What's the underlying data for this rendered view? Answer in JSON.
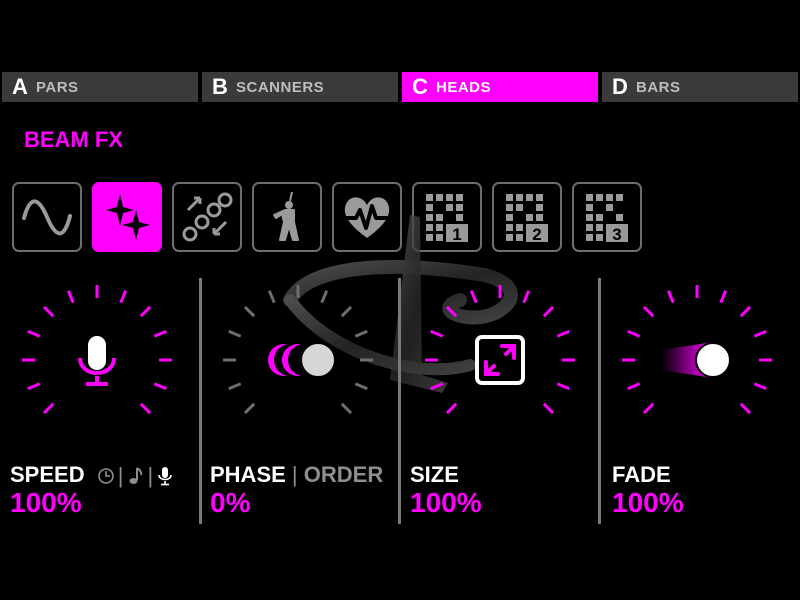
{
  "tabs": [
    {
      "letter": "A",
      "label": "PARS",
      "active": false
    },
    {
      "letter": "B",
      "label": "SCANNERS",
      "active": false
    },
    {
      "letter": "C",
      "label": "HEADS",
      "active": true
    },
    {
      "letter": "D",
      "label": "BARS",
      "active": false
    }
  ],
  "section": {
    "title": "BEAM FX"
  },
  "effects": [
    {
      "icon": "sine-wave-icon",
      "active": false
    },
    {
      "icon": "sparkle-icon",
      "active": true
    },
    {
      "icon": "dots-arrows-icon",
      "active": false
    },
    {
      "icon": "dancer-icon",
      "active": false
    },
    {
      "icon": "heartbeat-icon",
      "active": false
    },
    {
      "icon": "grid-pattern-1-icon",
      "active": false,
      "badge": "1"
    },
    {
      "icon": "grid-pattern-2-icon",
      "active": false,
      "badge": "2"
    },
    {
      "icon": "grid-pattern-3-icon",
      "active": false,
      "badge": "3"
    }
  ],
  "params": {
    "speed": {
      "label": "SPEED",
      "value": "100%",
      "level": 1.0,
      "icon": "microphone-icon",
      "modes": [
        "clock-icon",
        "music-note-icon",
        "microphone-icon"
      ]
    },
    "phase": {
      "label": "PHASE",
      "alt_label": "ORDER",
      "value": "0%",
      "level": 0.0,
      "icon": "phase-circles-icon"
    },
    "size": {
      "label": "SIZE",
      "value": "100%",
      "level": 1.0,
      "icon": "expand-icon"
    },
    "fade": {
      "label": "FADE",
      "value": "100%",
      "level": 1.0,
      "icon": "fade-ball-icon"
    }
  },
  "colors": {
    "accent": "#ff00ff",
    "inactive": "#6e6e6e",
    "background": "#000000"
  }
}
